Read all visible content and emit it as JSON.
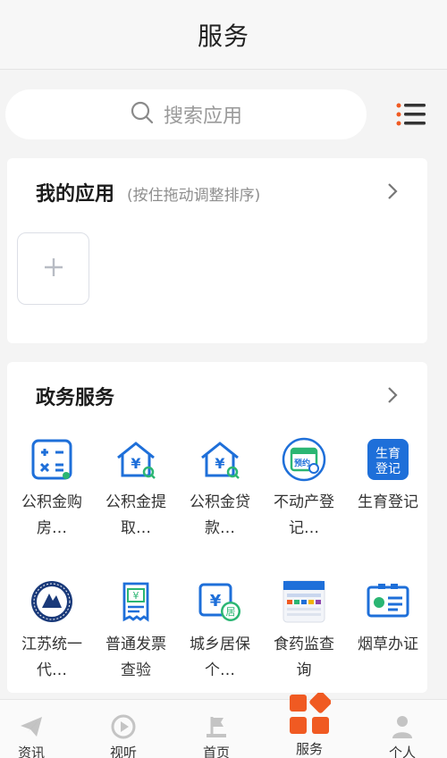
{
  "header": {
    "title": "服务"
  },
  "search": {
    "placeholder": "搜索应用"
  },
  "my_apps": {
    "title": "我的应用",
    "hint": "(按住拖动调整排序)"
  },
  "gov_services": {
    "title": "政务服务",
    "apps": [
      {
        "label": "公积金购房…",
        "icon": "calculator-icon"
      },
      {
        "label": "公积金提取…",
        "icon": "house-yuan-icon"
      },
      {
        "label": "公积金贷款…",
        "icon": "house-yuan-search-icon"
      },
      {
        "label": "不动产登记…",
        "icon": "calendar-appointment-icon",
        "badge": "预约"
      },
      {
        "label": "生育登记",
        "icon": "birth-registration-icon",
        "badge": "生育登记"
      },
      {
        "label": "江苏统一代…",
        "icon": "jiangsu-emblem-icon"
      },
      {
        "label": "普通发票查验",
        "icon": "invoice-icon"
      },
      {
        "label": "城乡居保个…",
        "icon": "pension-icon",
        "badge": "居"
      },
      {
        "label": "食药监查询",
        "icon": "food-drug-icon"
      },
      {
        "label": "烟草办证",
        "icon": "id-card-icon"
      }
    ]
  },
  "tabbar": {
    "items": [
      {
        "label": "资讯",
        "icon": "paper-plane-icon"
      },
      {
        "label": "视听",
        "icon": "play-icon"
      },
      {
        "label": "首页",
        "icon": "home-flag-icon"
      },
      {
        "label": "服务",
        "icon": "service-blocks-icon"
      },
      {
        "label": "个人",
        "icon": "person-icon"
      }
    ],
    "active": "服务"
  },
  "colors": {
    "brand_blue": "#1e6fd9",
    "accent_orange": "#f05a22"
  }
}
